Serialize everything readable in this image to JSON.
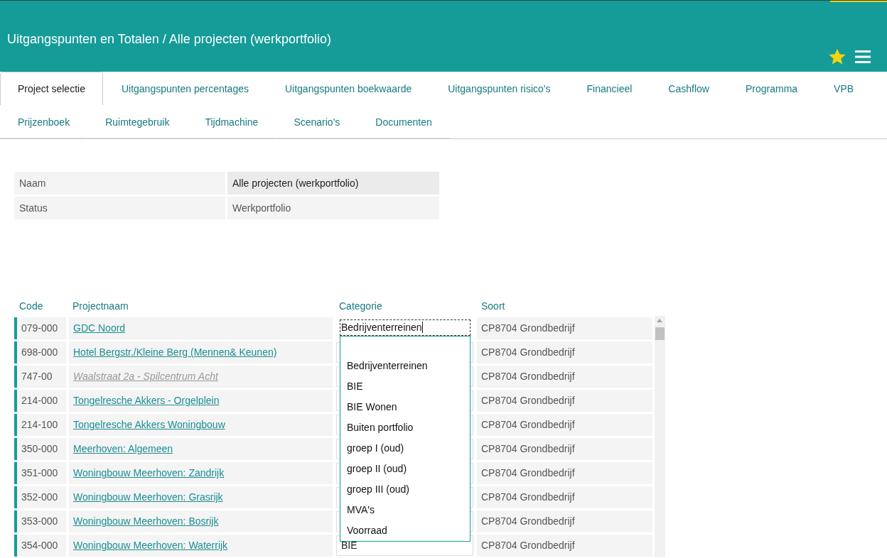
{
  "header": {
    "title": "Uitgangspunten en Totalen / Alle projecten (werkportfolio)",
    "favorite": true
  },
  "tabs": [
    [
      {
        "label": "Project selectie",
        "selected": true
      },
      {
        "label": "Uitgangspunten percentages",
        "selected": false
      },
      {
        "label": "Uitgangspunten boekwaarde",
        "selected": false
      },
      {
        "label": "Uitgangspunten risico's",
        "selected": false
      },
      {
        "label": "Financieel",
        "selected": false
      },
      {
        "label": "Cashflow",
        "selected": false
      },
      {
        "label": "Programma",
        "selected": false
      },
      {
        "label": "VPB",
        "selected": false
      }
    ],
    [
      {
        "label": "Prijzenboek",
        "selected": false
      },
      {
        "label": "Ruimtegebruik",
        "selected": false
      },
      {
        "label": "Tijdmachine",
        "selected": false
      },
      {
        "label": "Scenario's",
        "selected": false
      },
      {
        "label": "Documenten",
        "selected": false
      }
    ]
  ],
  "details": [
    {
      "label": "Naam",
      "value": "Alle projecten (werkportfolio)",
      "highlighted": true
    },
    {
      "label": "Status",
      "value": "Werkportfolio",
      "highlighted": false
    }
  ],
  "table": {
    "columns": [
      "Code",
      "Projectnaam",
      "Categorie",
      "Soort"
    ],
    "rows": [
      {
        "code": "079-000",
        "name": "GDC Noord",
        "inactive": false,
        "editing": true,
        "soort": "CP8704 Grondbedrijf"
      },
      {
        "code": "698-000",
        "name": "Hotel Bergstr./Kleine Berg (Mennen& Keunen)",
        "inactive": false,
        "editing": false,
        "soort": "CP8704 Grondbedrijf"
      },
      {
        "code": "747-00",
        "name": "Waalstraat 2a - Spilcentrum Acht",
        "inactive": true,
        "editing": false,
        "soort": "CP8704 Grondbedrijf"
      },
      {
        "code": "214-000",
        "name": "Tongelresche Akkers - Orgelplein",
        "inactive": false,
        "editing": false,
        "soort": "CP8704 Grondbedrijf"
      },
      {
        "code": "214-100",
        "name": "Tongelresche Akkers Woningbouw",
        "inactive": false,
        "editing": false,
        "soort": "CP8704 Grondbedrijf"
      },
      {
        "code": "350-000",
        "name": "Meerhoven: Algemeen",
        "inactive": false,
        "editing": false,
        "soort": "CP8704 Grondbedrijf"
      },
      {
        "code": "351-000",
        "name": "Woningbouw Meerhoven: Zandrijk",
        "inactive": false,
        "editing": false,
        "soort": "CP8704 Grondbedrijf"
      },
      {
        "code": "352-000",
        "name": "Woningbouw Meerhoven: Grasrijk",
        "inactive": false,
        "editing": false,
        "soort": "CP8704 Grondbedrijf"
      },
      {
        "code": "353-000",
        "name": "Woningbouw Meerhoven: Bosrijk",
        "inactive": false,
        "editing": false,
        "soort": "CP8704 Grondbedrijf"
      },
      {
        "code": "354-000",
        "name": "Woningbouw Meerhoven: Waterrijk",
        "inactive": false,
        "editing": false,
        "category": "BIE",
        "soort": "CP8704 Grondbedrijf"
      }
    ]
  },
  "category_editor": {
    "value": "Bedrijventerreinen",
    "options": [
      "Bedrijventerreinen",
      "BIE",
      "BIE Wonen",
      "Buiten portfolio",
      "groep I (oud)",
      "groep II (oud)",
      "groep III (oud)",
      "MVA's",
      "Voorraad"
    ]
  }
}
